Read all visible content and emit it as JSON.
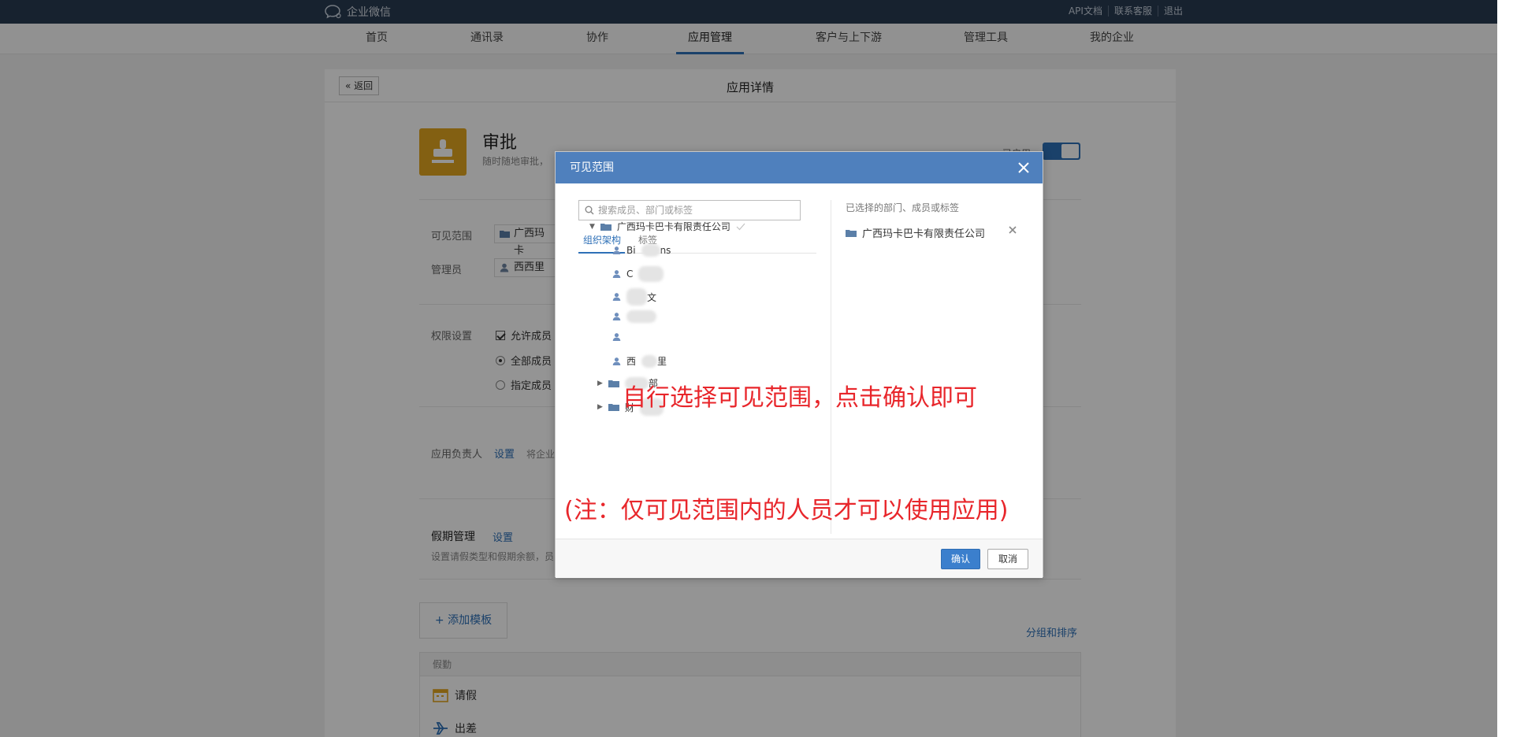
{
  "topbar": {
    "logo_text": "企业微信",
    "links": [
      "API文档",
      "联系客服",
      "退出"
    ]
  },
  "nav": {
    "items": [
      "首页",
      "通讯录",
      "协作",
      "应用管理",
      "客户与上下游",
      "管理工具",
      "我的企业"
    ],
    "active": "应用管理"
  },
  "page": {
    "back_label": "返回",
    "title": "应用详情"
  },
  "app": {
    "name": "审批",
    "description": "随时随地审批，",
    "enabled_label": "已启用"
  },
  "fields": {
    "visible_label": "可见范围",
    "visible_value": "广西玛卡",
    "admin_label": "管理员",
    "admin_value": "西西里",
    "perm_label": "权限设置",
    "perm_option1": "允许成员",
    "perm_option2": "全部成员",
    "perm_option3": "指定成员",
    "owner_label": "应用负责人",
    "owner_link": "设置",
    "owner_hint": "将企业",
    "holiday_label": "假期管理",
    "holiday_link": "设置",
    "holiday_desc": "设置请假类型和假期余额，员"
  },
  "templates": {
    "add_label": "添加模板",
    "group_sort": "分组和排序",
    "section_label": "假勤",
    "items": [
      "请假",
      "出差"
    ]
  },
  "modal": {
    "title": "可见范围",
    "search_placeholder": "搜索成员、部门或标签",
    "tabs": [
      "组织架构",
      "标签"
    ],
    "root_org": "广西玛卡巴卡有限责任公司",
    "members": [
      "Bi",
      "ns",
      "C",
      "",
      "",
      "文",
      "",
      "",
      "",
      "",
      "西",
      "里"
    ],
    "depts": [
      "",
      "部",
      "财",
      ""
    ],
    "selected_title": "已选择的部门、成员或标签",
    "selected_item": "广西玛卡巴卡有限责任公司",
    "ok_label": "确认",
    "cancel_label": "取消"
  },
  "annotations": {
    "line1": "自行选择可见范围，点击确认即可",
    "line2": "(注：仅可见范围内的人员才可以使用应用)"
  },
  "colors": {
    "topbar": "#293b52",
    "accent": "#2e70b7",
    "modal_header": "#4f80bd",
    "annotation": "#e8262b",
    "app_icon": "#e2a520"
  }
}
